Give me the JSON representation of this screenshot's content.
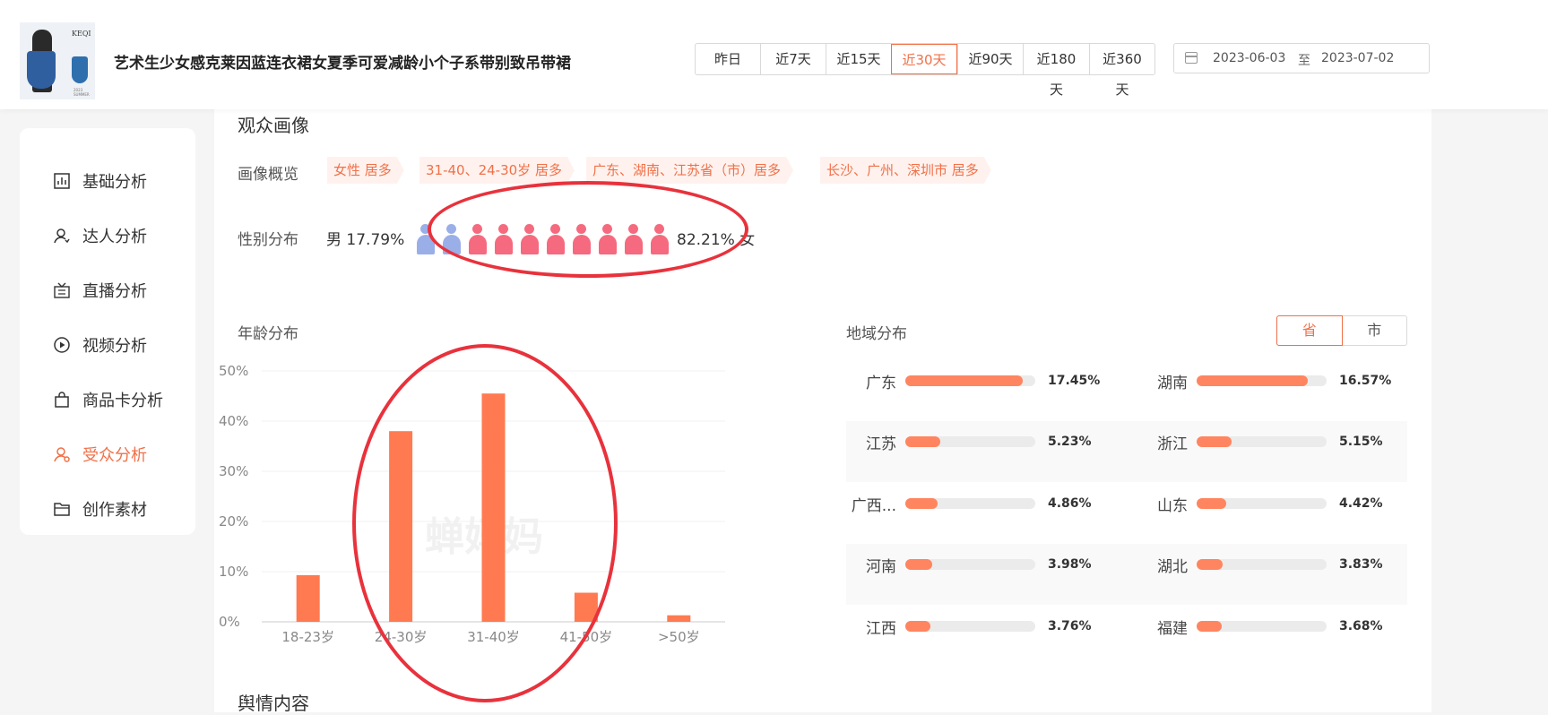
{
  "product": {
    "title": "艺术生少女感克莱因蓝连衣裙女夏季可爱减龄小个子系带别致吊带裙",
    "thumb_brand": "KEQI",
    "thumb_note": "2023 SUMMER"
  },
  "date_ranges": [
    "昨日",
    "近7天",
    "近15天",
    "近30天",
    "近90天",
    "近180天",
    "近360天"
  ],
  "active_range": "近30天",
  "date_picker": {
    "start": "2023-06-03",
    "separator": "至",
    "end": "2023-07-02"
  },
  "sidebar": {
    "items": [
      {
        "label": "基础分析",
        "icon": "bar-chart-icon"
      },
      {
        "label": "达人分析",
        "icon": "user-icon"
      },
      {
        "label": "直播分析",
        "icon": "live-icon"
      },
      {
        "label": "视频分析",
        "icon": "play-icon"
      },
      {
        "label": "商品卡分析",
        "icon": "bag-icon"
      },
      {
        "label": "受众分析",
        "icon": "audience-icon",
        "active": true
      },
      {
        "label": "创作素材",
        "icon": "folder-icon"
      }
    ]
  },
  "portrait": {
    "section_title": "观众画像",
    "overview_label": "画像概览",
    "tags": [
      "女性 居多",
      "31-40、24-30岁 居多",
      "广东、湖南、江苏省（市）居多",
      "长沙、广州、深圳市 居多"
    ],
    "gender_label": "性别分布",
    "male_text": "男 17.79%",
    "female_text": "82.21% 女",
    "male_icons": 2,
    "female_icons": 8,
    "male_color": "#9aaee8",
    "female_color": "#f56a7e"
  },
  "age": {
    "title": "年龄分布",
    "watermark": "蝉妈妈"
  },
  "chart_data": {
    "type": "bar",
    "title": "年龄分布",
    "categories": [
      "18-23岁",
      "24-30岁",
      "31-40岁",
      "41-50岁",
      ">50岁"
    ],
    "values": [
      9.3,
      38,
      45.5,
      5.8,
      1.3
    ],
    "y_ticks": [
      "0%",
      "10%",
      "20%",
      "30%",
      "40%",
      "50%"
    ],
    "ylim": [
      0,
      50
    ],
    "grid": true,
    "color": "#ff7a50"
  },
  "region": {
    "title": "地域分布",
    "toggle": [
      "省",
      "市"
    ],
    "toggle_active": "省",
    "left": [
      {
        "name": "广东",
        "pct": "17.45%",
        "value": 17.45
      },
      {
        "name": "江苏",
        "pct": "5.23%",
        "value": 5.23
      },
      {
        "name": "广西...",
        "pct": "4.86%",
        "value": 4.86
      },
      {
        "name": "河南",
        "pct": "3.98%",
        "value": 3.98
      },
      {
        "name": "江西",
        "pct": "3.76%",
        "value": 3.76
      }
    ],
    "right": [
      {
        "name": "湖南",
        "pct": "16.57%",
        "value": 16.57
      },
      {
        "name": "浙江",
        "pct": "5.15%",
        "value": 5.15
      },
      {
        "name": "山东",
        "pct": "4.42%",
        "value": 4.42
      },
      {
        "name": "湖北",
        "pct": "3.83%",
        "value": 3.83
      },
      {
        "name": "福建",
        "pct": "3.68%",
        "value": 3.68
      }
    ],
    "max_value": 17.45
  },
  "sentiment": {
    "title": "舆情内容"
  },
  "annotation_color": "#e8323c"
}
